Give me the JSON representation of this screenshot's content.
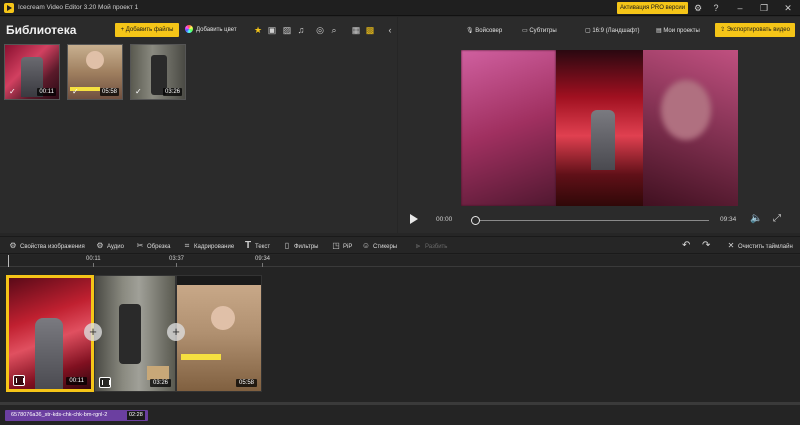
{
  "app": {
    "name": "Icecream Video Editor 3.20",
    "project": "Мой проект 1",
    "pro_label": "Активация PRO версии",
    "accent": "#f5c518"
  },
  "library": {
    "title": "Библиотека",
    "add_files": "+ Добавить файлы",
    "add_color": "Добавить цвет",
    "toolbar_icons": [
      "star-icon",
      "video-filter-icon",
      "image-filter-icon",
      "music-filter-icon",
      "record-icon",
      "search-icon",
      "list-view-icon",
      "grid-view-icon",
      "collapse-panel-icon"
    ],
    "items": [
      {
        "duration": "00:11",
        "checked": true
      },
      {
        "duration": "05:58",
        "checked": true
      },
      {
        "duration": "03:26",
        "checked": true
      }
    ]
  },
  "preview": {
    "voiceover": "Войсовер",
    "subtitles": "Субтитры",
    "aspect": "16:9 (Ландшафт)",
    "my_projects": "Мои проекты",
    "export": "Экспортировать видео",
    "current_time": "00:00",
    "total_time": "09:34"
  },
  "tools": {
    "image_props": "Свойства изображения",
    "audio": "Аудио",
    "trim": "Обрезка",
    "crop": "Кадрирование",
    "text": "Текст",
    "filters": "Фильтры",
    "pip": "PiP",
    "stickers": "Стикеры",
    "split": "Разбить",
    "clear_timeline": "Очистить таймлайн"
  },
  "timeline": {
    "ruler": [
      "00:11",
      "03:37",
      "09:34"
    ],
    "clips": [
      {
        "duration": "00:11",
        "selected": true
      },
      {
        "duration": "03:26",
        "selected": false
      },
      {
        "duration": "05:58",
        "selected": false
      }
    ],
    "audio": {
      "name": "6578076a36_str-kds-chk-chk-bm-rgnl-2",
      "duration": "02:28"
    }
  }
}
